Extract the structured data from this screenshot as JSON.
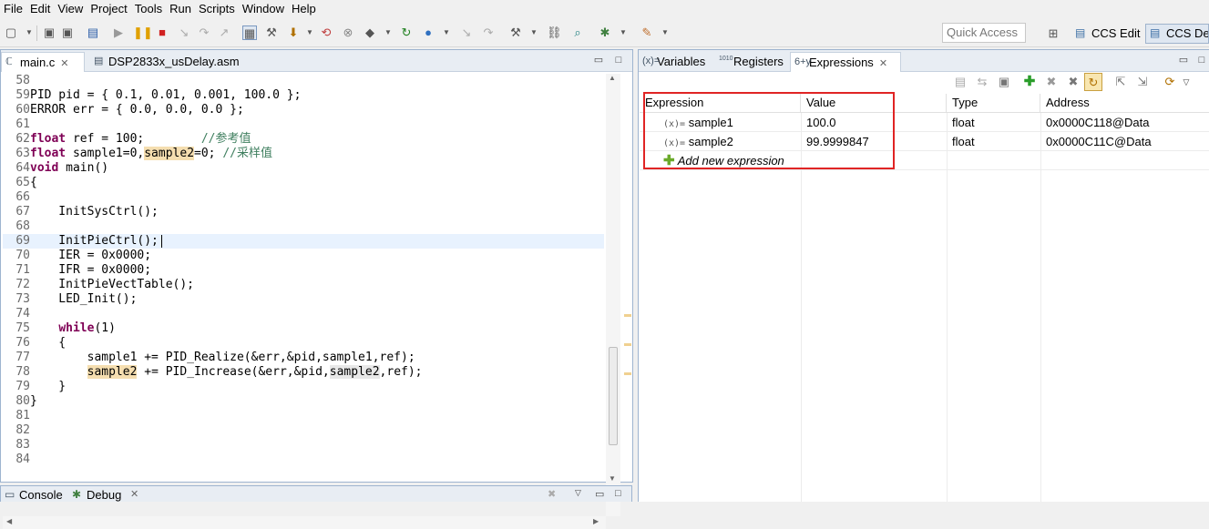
{
  "menu": [
    "File",
    "Edit",
    "View",
    "Project",
    "Tools",
    "Run",
    "Scripts",
    "Window",
    "Help"
  ],
  "quick_access": "Quick Access",
  "perspectives": [
    {
      "label": "CCS Edit",
      "active": false
    },
    {
      "label": "CCS Deb",
      "active": true
    }
  ],
  "editor": {
    "tabs": [
      {
        "label": "main.c",
        "active": true
      },
      {
        "label": "DSP2833x_usDelay.asm",
        "active": false
      }
    ],
    "lines": [
      {
        "n": "58",
        "t": ""
      },
      {
        "n": "59",
        "t": "PID pid = { 0.1, 0.01, 0.001, 100.0 };"
      },
      {
        "n": "60",
        "t": "ERROR err = { 0.0, 0.0, 0.0 };"
      },
      {
        "n": "61",
        "t": ""
      },
      {
        "n": "62",
        "kw": "float",
        "t": " ref = 100;        ",
        "cm": "//参考值"
      },
      {
        "n": "63",
        "kw": "float",
        "t": " sample1=0,",
        "hl": "sample2",
        "t2": "=0; ",
        "cm": "//采样值"
      },
      {
        "n": "64",
        "kw": "void",
        "t": " main()"
      },
      {
        "n": "65",
        "t": "{"
      },
      {
        "n": "66",
        "t": ""
      },
      {
        "n": "67",
        "t": "    InitSysCtrl();"
      },
      {
        "n": "68",
        "t": ""
      },
      {
        "n": "69",
        "t": "    InitPieCtrl();",
        "cur": true
      },
      {
        "n": "70",
        "t": "    IER = 0x0000;"
      },
      {
        "n": "71",
        "t": "    IFR = 0x0000;"
      },
      {
        "n": "72",
        "t": "    InitPieVectTable();"
      },
      {
        "n": "73",
        "t": "    LED_Init();"
      },
      {
        "n": "74",
        "t": ""
      },
      {
        "n": "75",
        "pre": "    ",
        "kw": "while",
        "t": "(1)"
      },
      {
        "n": "76",
        "t": "    {"
      },
      {
        "n": "77",
        "t": "        sample1 += PID_Realize(&err,&pid,sample1,ref);"
      },
      {
        "n": "78",
        "pre": "        ",
        "hl": "sample2",
        "t2": " += PID_Increase(&err,&pid,",
        "hl2": "sample2",
        "t3": ",ref);"
      },
      {
        "n": "79",
        "t": "    }"
      },
      {
        "n": "80",
        "t": "}"
      },
      {
        "n": "81",
        "t": ""
      },
      {
        "n": "82",
        "t": ""
      },
      {
        "n": "83",
        "t": ""
      },
      {
        "n": "84",
        "t": ""
      }
    ]
  },
  "bottom": {
    "tabs": [
      {
        "label": "Console"
      },
      {
        "label": "Debug"
      }
    ]
  },
  "views": {
    "tabs": [
      {
        "label": "Variables",
        "icon": "(x)="
      },
      {
        "label": "Registers",
        "icon": "1010"
      },
      {
        "label": "Expressions",
        "icon": "6+y",
        "active": true
      }
    ]
  },
  "expressions": {
    "headers": [
      "Expression",
      "Value",
      "Type",
      "Address"
    ],
    "rows": [
      {
        "expression": "sample1",
        "value": "100.0",
        "type": "float",
        "address": "0x0000C118@Data"
      },
      {
        "expression": "sample2",
        "value": "99.9999847",
        "type": "float",
        "address": "0x0000C11C@Data"
      }
    ],
    "add_new": "Add new expression",
    "var_icon": "(x)="
  },
  "colors": {
    "highlight_box": "#e02424",
    "keyword": "#7f0055",
    "comment": "#3f7f5f",
    "current_line": "#e8f2fe",
    "occurrence": "#f5deb0"
  }
}
